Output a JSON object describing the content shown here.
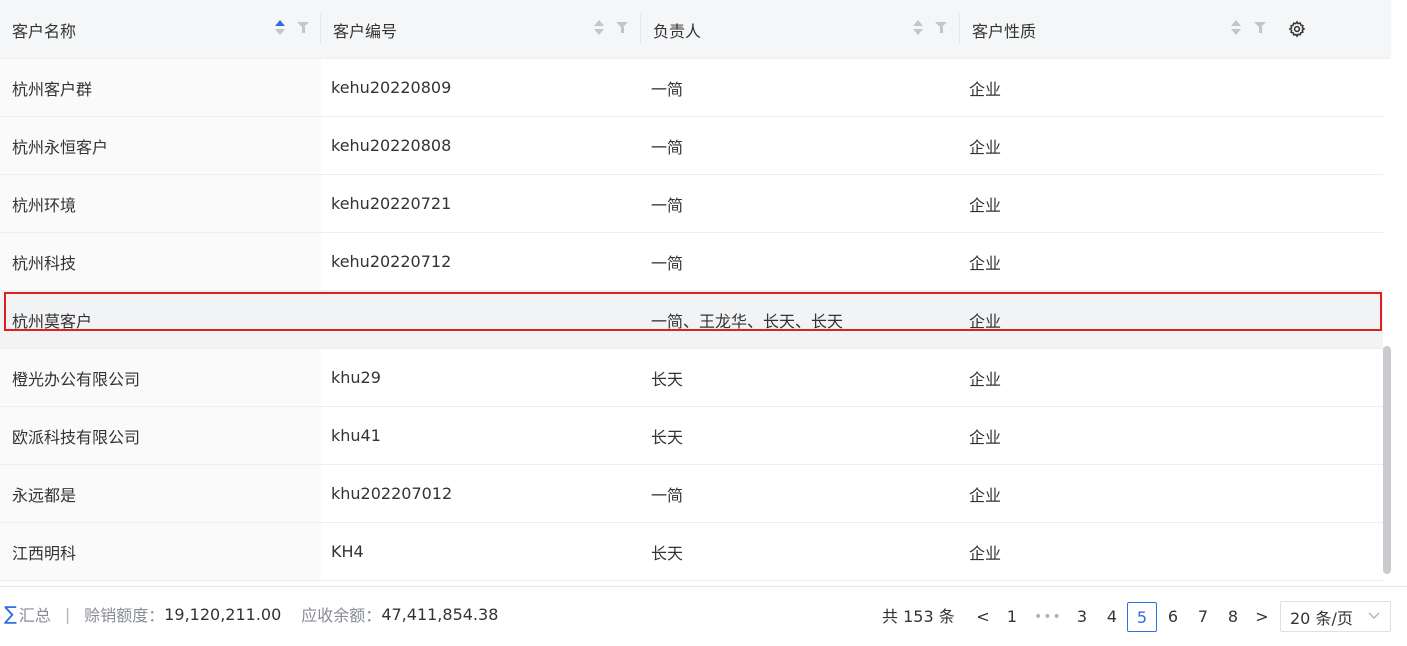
{
  "columns": [
    {
      "label": "客户名称"
    },
    {
      "label": "客户编号"
    },
    {
      "label": "负责人"
    },
    {
      "label": "客户性质"
    }
  ],
  "rows": [
    {
      "name": "杭州客户群",
      "code": "kehu20220809",
      "owner": "一简",
      "type": "企业"
    },
    {
      "name": "杭州永恒客户",
      "code": "kehu20220808",
      "owner": "一简",
      "type": "企业"
    },
    {
      "name": "杭州环境",
      "code": "kehu20220721",
      "owner": "一简",
      "type": "企业"
    },
    {
      "name": "杭州科技",
      "code": "kehu20220712",
      "owner": "一简",
      "type": "企业"
    },
    {
      "name": "杭州莫客户",
      "code": "",
      "owner": "一简、王龙华、长天、长天",
      "type": "企业"
    },
    {
      "name": "橙光办公有限公司",
      "code": "khu29",
      "owner": "长天",
      "type": "企业"
    },
    {
      "name": "欧派科技有限公司",
      "code": "khu41",
      "owner": "长天",
      "type": "企业"
    },
    {
      "name": "永远都是",
      "code": "khu202207012",
      "owner": "一简",
      "type": "企业"
    },
    {
      "name": "江西明科",
      "code": "KH4",
      "owner": "长天",
      "type": "企业"
    }
  ],
  "selected_row_index": 4,
  "summary": {
    "label": "汇总",
    "divider": "|",
    "items": [
      {
        "key": "赊销额度：",
        "value": "19,120,211.00"
      },
      {
        "key": "应收余额：",
        "value": "47,411,854.38"
      }
    ]
  },
  "pagination": {
    "total": "共 153 条",
    "prev": "<",
    "next": ">",
    "ellipsis": "•••",
    "pages": [
      "1",
      "3",
      "4",
      "5",
      "6",
      "7",
      "8"
    ],
    "current": "5",
    "page_size": "20 条/页"
  },
  "icons": {
    "sort": "sort-icon",
    "filter": "filter-icon",
    "settings": "gear-icon",
    "sigma": "sigma-icon",
    "chevron": "chevron-down-icon"
  },
  "colors": {
    "accent": "#2f6fe4",
    "highlight": "#e02020",
    "header_bg": "#f5f6f7"
  }
}
